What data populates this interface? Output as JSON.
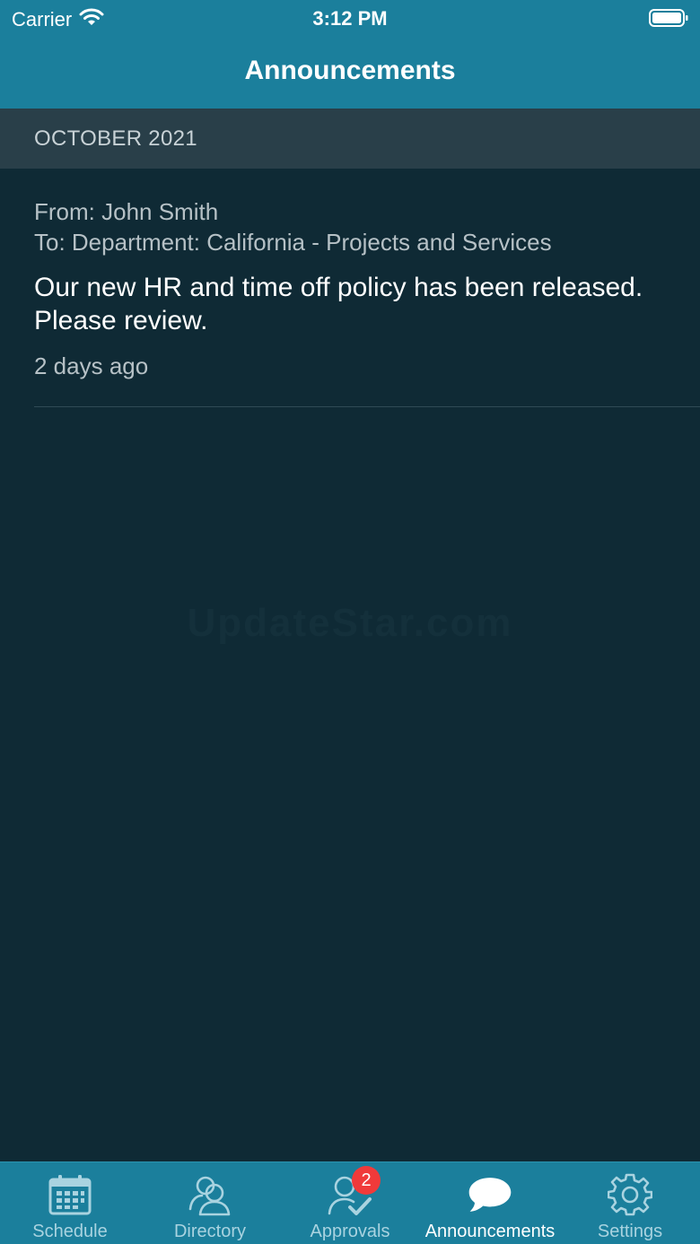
{
  "status_bar": {
    "carrier": "Carrier",
    "time": "3:12 PM"
  },
  "header": {
    "title": "Announcements"
  },
  "section": {
    "label": "OCTOBER 2021"
  },
  "announcement": {
    "from": "From: John Smith",
    "to": "To: Department: California - Projects and Services",
    "message": "Our new HR and time off policy has been released. Please review.",
    "time_ago": "2 days ago"
  },
  "watermark": "UpdateStar.com",
  "tabs": [
    {
      "label": "Schedule",
      "icon": "calendar-icon"
    },
    {
      "label": "Directory",
      "icon": "people-icon"
    },
    {
      "label": "Approvals",
      "icon": "approve-user-icon",
      "badge": "2"
    },
    {
      "label": "Announcements",
      "icon": "speech-bubble-icon",
      "active": true
    },
    {
      "label": "Settings",
      "icon": "gear-icon"
    }
  ],
  "colors": {
    "bar": "#1b7f9c",
    "background": "#0f2a35",
    "section_header": "#293f49",
    "badge": "#f03a3a"
  }
}
